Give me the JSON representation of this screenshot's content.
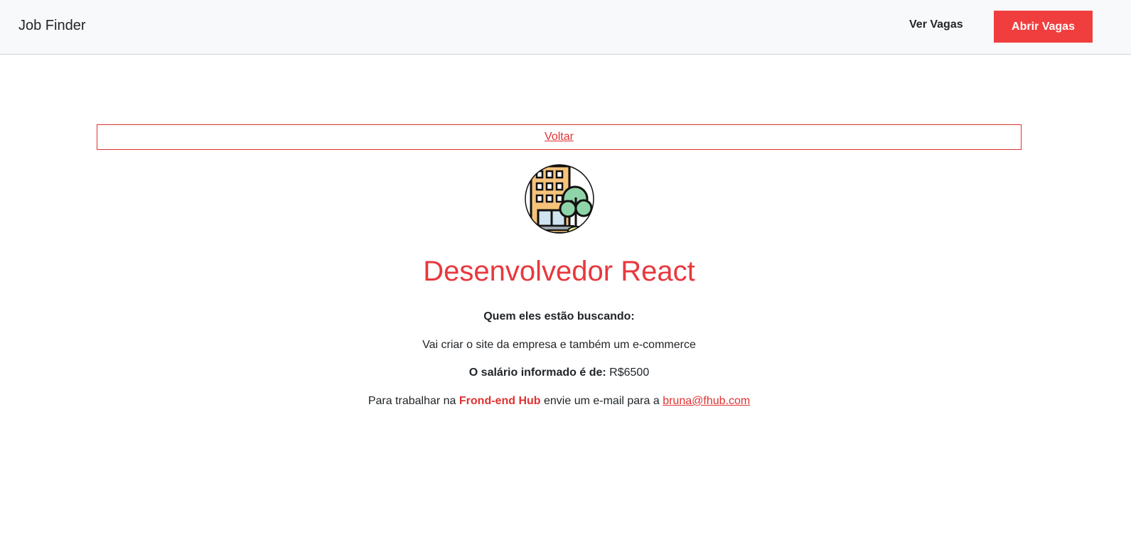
{
  "navbar": {
    "brand": "Job Finder",
    "link_label": "Ver Vagas",
    "button_label": "Abrir Vagas"
  },
  "back_label": "Voltar",
  "logo_icon": "company-building-icon",
  "job": {
    "title": "Desenvolvedor React",
    "looking_for_label": "Quem eles estão buscando:",
    "description": "Vai criar o site da empresa e também um e-commerce",
    "salary_label": "O salário informado é de:",
    "salary_value": "R$6500",
    "contact_prefix": "Para trabalhar na",
    "company": "Frond-end Hub",
    "contact_middle": "envie um e-mail para a",
    "email": "bruna@fhub.com"
  },
  "colors": {
    "accent": "#f03e3e",
    "navbar_bg": "#f8f9fa"
  }
}
